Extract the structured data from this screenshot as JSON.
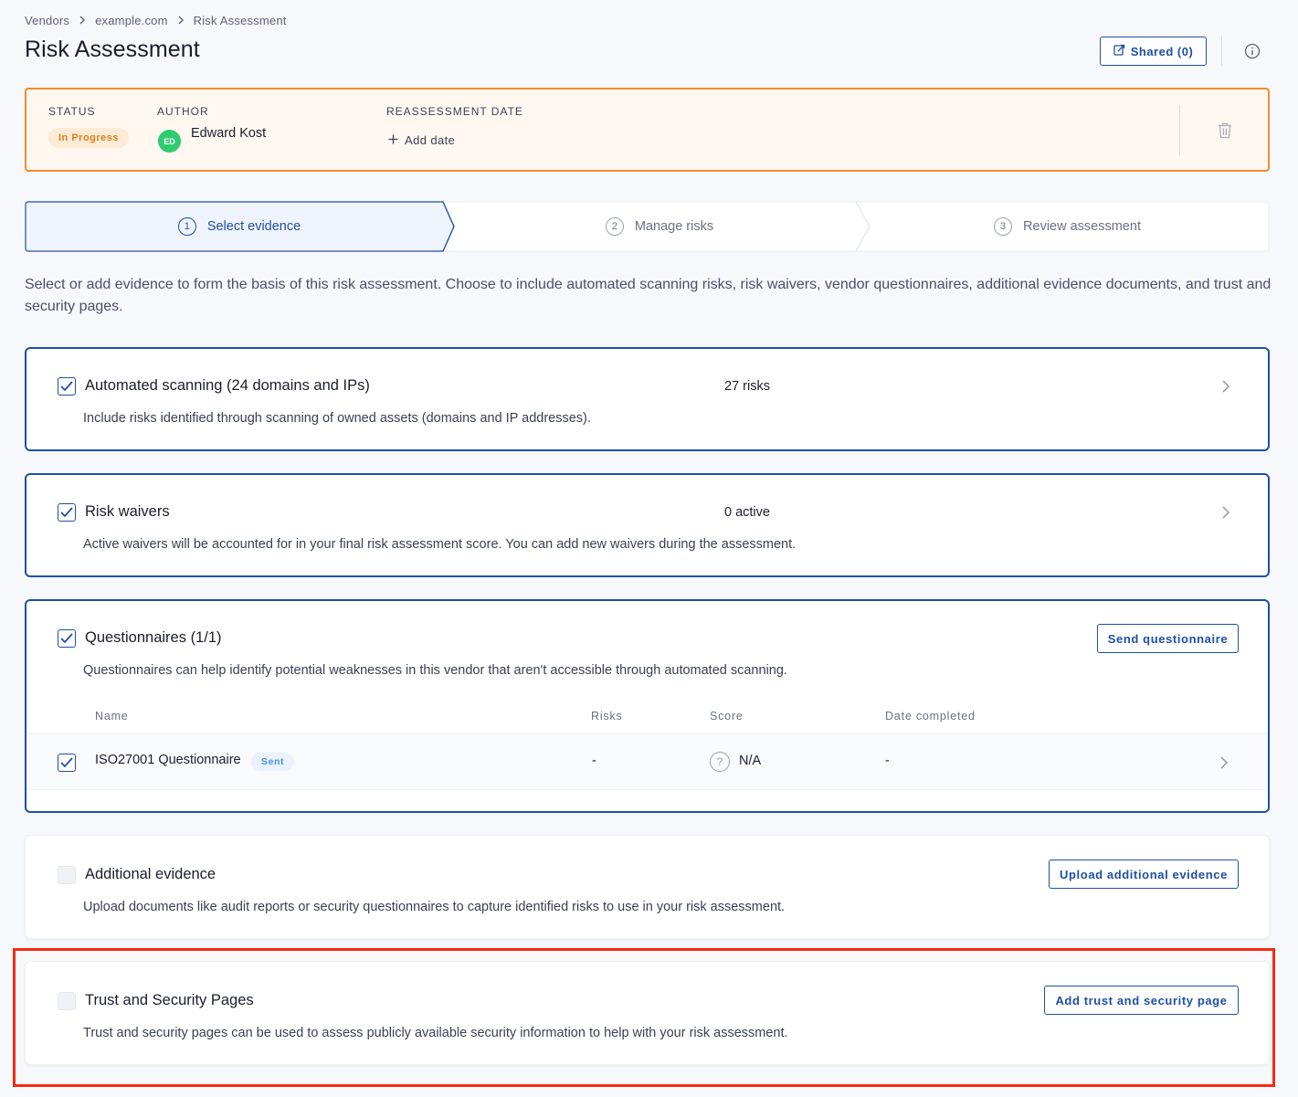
{
  "breadcrumb": {
    "items": [
      "Vendors",
      "example.com",
      "Risk Assessment"
    ]
  },
  "header": {
    "title": "Risk Assessment",
    "shared_label": "Shared (0)"
  },
  "status_bar": {
    "status_label": "STATUS",
    "status_value": "In Progress",
    "author_label": "AUTHOR",
    "author_initials": "ED",
    "author_name": "Edward Kost",
    "reassessment_label": "REASSESSMENT DATE",
    "add_date_label": "Add date"
  },
  "stepper": {
    "steps": [
      {
        "num": "1",
        "label": "Select evidence"
      },
      {
        "num": "2",
        "label": "Manage risks"
      },
      {
        "num": "3",
        "label": "Review assessment"
      }
    ]
  },
  "intro": "Select or add evidence to form the basis of this risk assessment. Choose to include automated scanning risks, risk waivers, vendor questionnaires, additional evidence documents, and trust and security pages.",
  "cards": {
    "scanning": {
      "title": "Automated scanning (24 domains and IPs)",
      "count": "27 risks",
      "desc": "Include risks identified through scanning of owned assets (domains and IP addresses)."
    },
    "waivers": {
      "title": "Risk waivers",
      "count": "0 active",
      "desc": "Active waivers will be accounted for in your final risk assessment score. You can add new waivers during the assessment."
    },
    "questionnaires": {
      "title": "Questionnaires (1/1)",
      "desc": "Questionnaires can help identify potential weaknesses in this vendor that aren't accessible through automated scanning.",
      "button": "Send questionnaire",
      "columns": [
        "Name",
        "Risks",
        "Score",
        "Date completed"
      ],
      "rows": [
        {
          "name": "ISO27001 Questionnaire",
          "badge": "Sent",
          "risks": "-",
          "score_icon": "?",
          "score": "N/A",
          "date": "-"
        }
      ]
    },
    "additional": {
      "title": "Additional evidence",
      "desc": "Upload documents like audit reports or security questionnaires to capture identified risks to use in your risk assessment.",
      "button": "Upload additional evidence"
    },
    "trust": {
      "title": "Trust and Security Pages",
      "desc": "Trust and security pages can be used to assess publicly available security information to help with your risk assessment.",
      "button": "Add trust and security page"
    }
  },
  "colors": {
    "accent": "#1e4fa8",
    "status_border": "#f58a2c",
    "status_pill_text": "#d9821c",
    "highlight": "#f42a10"
  }
}
